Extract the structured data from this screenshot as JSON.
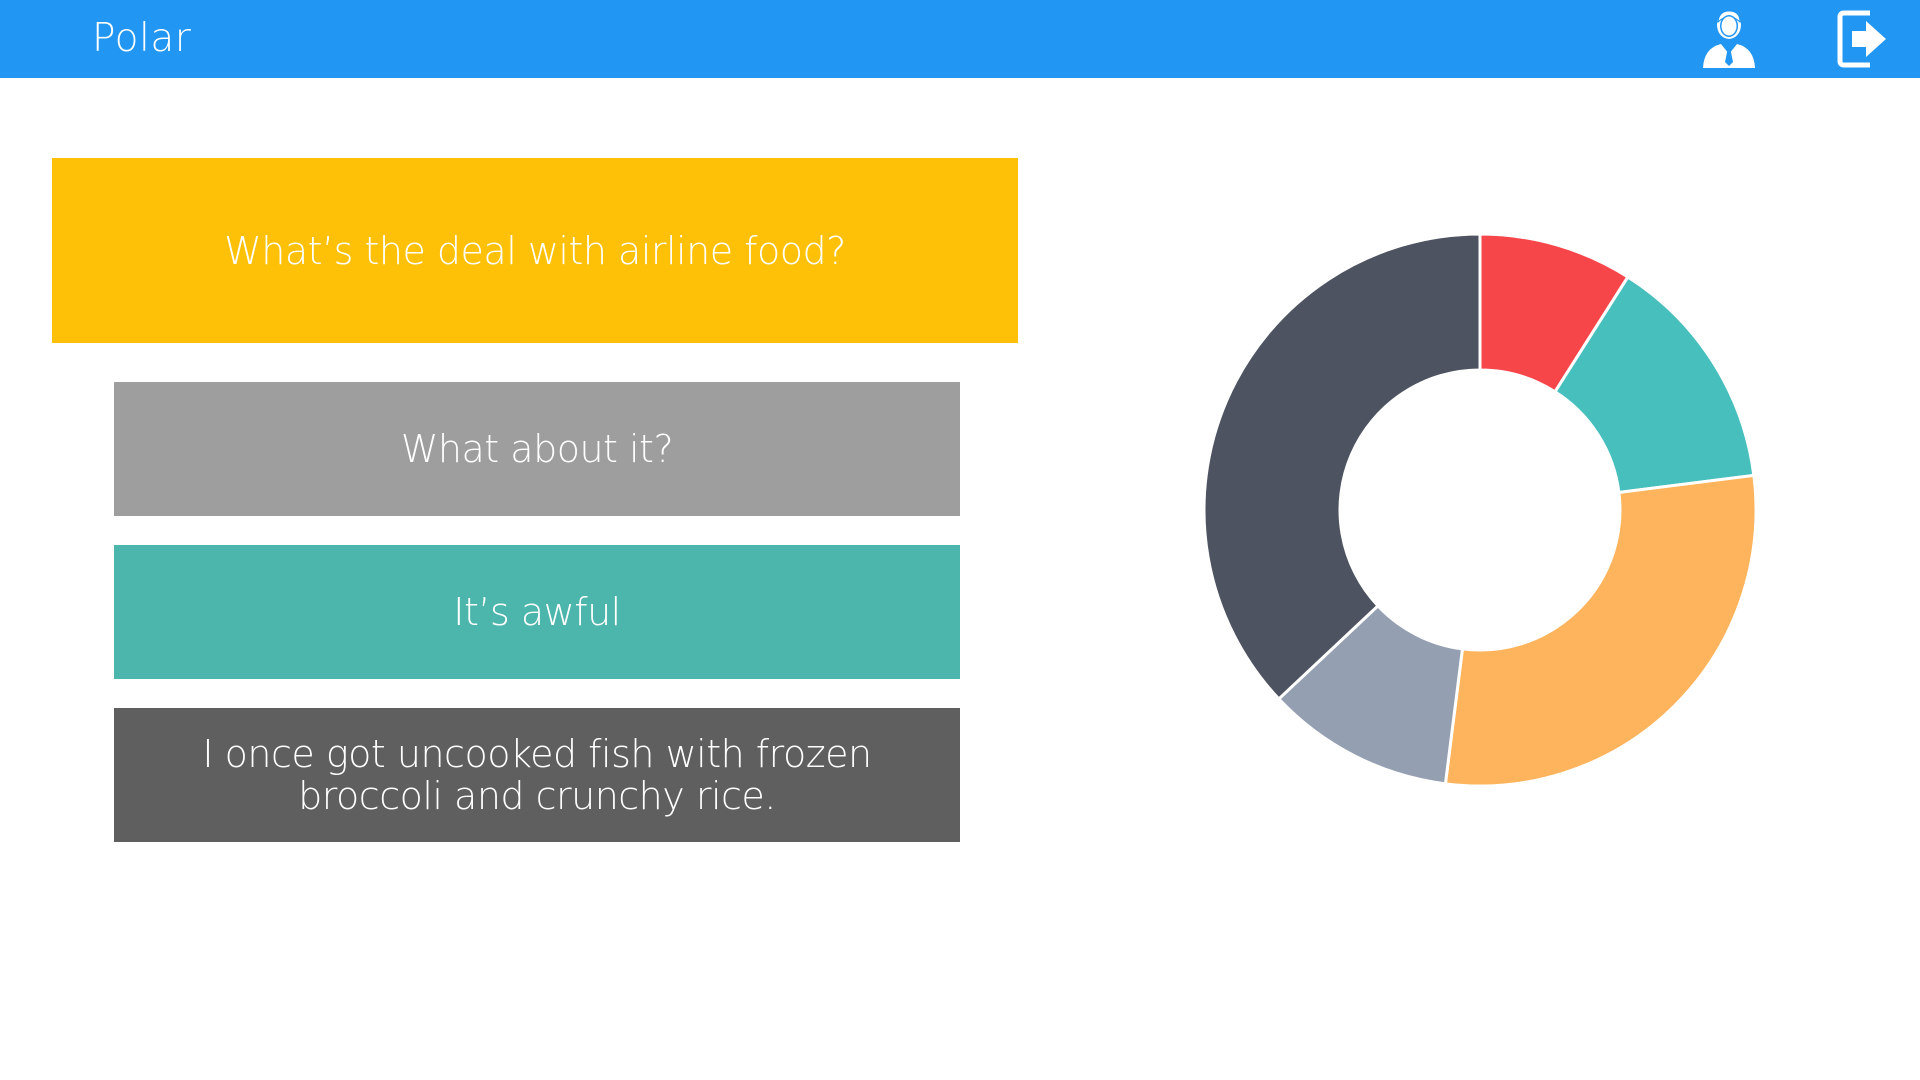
{
  "header": {
    "title": "Polar",
    "profile_icon": "user-profile-icon",
    "logout_icon": "logout-icon",
    "bar_color": "#2196f3"
  },
  "question": {
    "text": "What’s the deal with airline food?",
    "color": "#ffc107"
  },
  "answers": [
    {
      "text": "What about it?",
      "color": "#9e9e9e"
    },
    {
      "text": "It’s awful",
      "color": "#4db6ac"
    },
    {
      "text": "I once got uncooked fish with frozen broccoli and crunchy rice.",
      "color": "#5f5f5f"
    }
  ],
  "chart_data": {
    "type": "pie",
    "donut": true,
    "slices": [
      {
        "value": 9,
        "color": "#f7464a"
      },
      {
        "value": 14,
        "color": "#46bfbd"
      },
      {
        "value": 29,
        "color": "#fdb45c"
      },
      {
        "value": 11,
        "color": "#949fb1"
      },
      {
        "value": 37,
        "color": "#4d5360"
      }
    ]
  }
}
